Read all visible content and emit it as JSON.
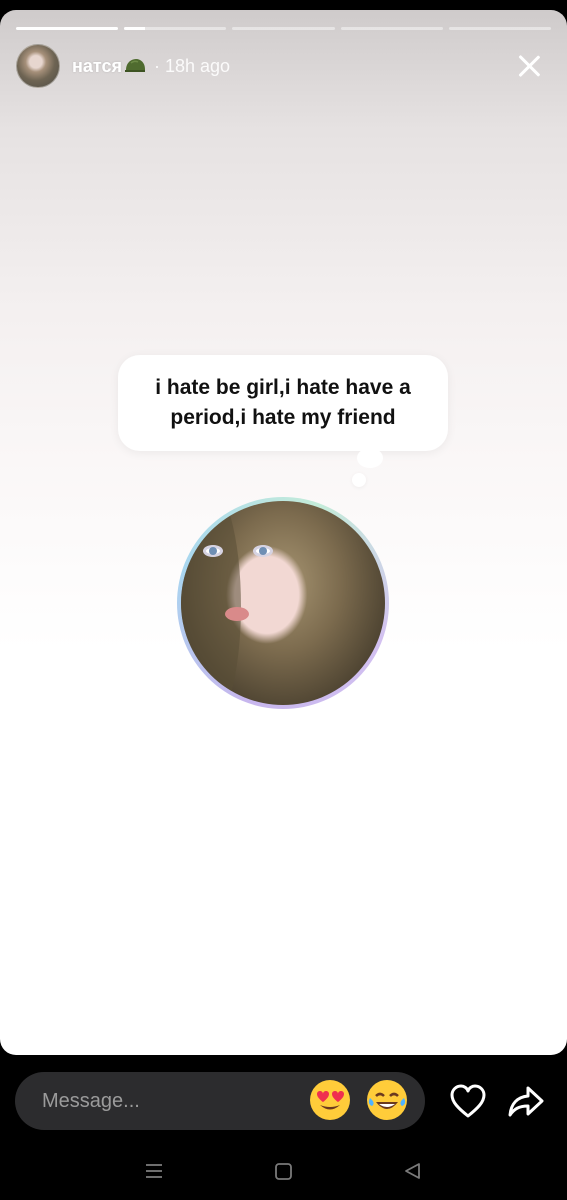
{
  "story": {
    "segments": [
      {
        "progress": 1.0
      },
      {
        "progress": 0.2
      },
      {
        "progress": 0.0
      },
      {
        "progress": 0.0
      },
      {
        "progress": 0.0
      }
    ],
    "username": "натся",
    "time_text": "· 18h ago",
    "close_icon": "close-icon",
    "note_text": "i hate be girl,i hate have a period,i hate my friend"
  },
  "composer": {
    "placeholder": "Message...",
    "emoji_1": "heart-eyes-emoji",
    "emoji_2": "tears-of-joy-emoji",
    "like_icon": "heart-icon",
    "share_icon": "share-arrow-icon"
  },
  "system_nav": {
    "menu_icon": "menu-icon",
    "home_icon": "home-square-icon",
    "back_icon": "back-triangle-icon"
  }
}
